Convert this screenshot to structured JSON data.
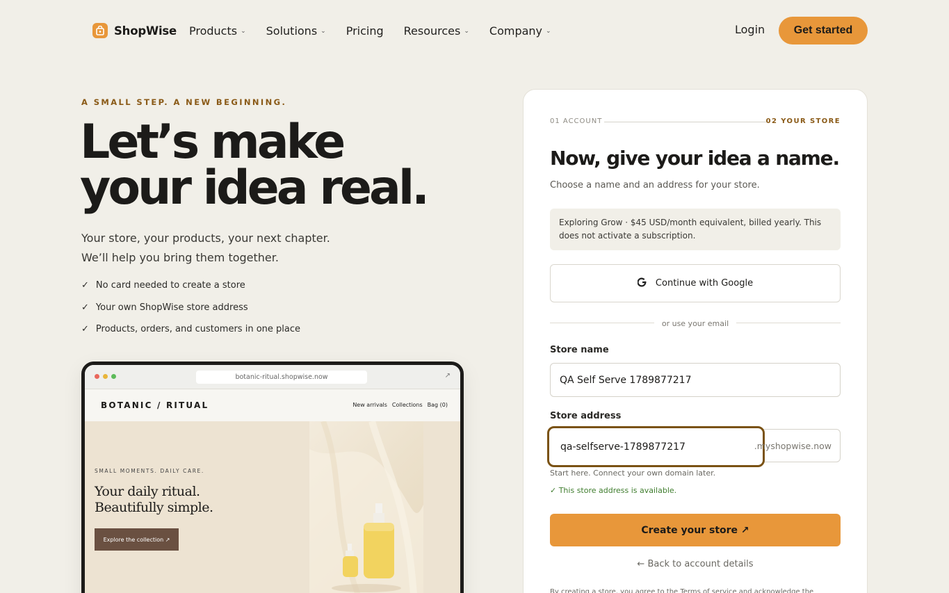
{
  "brand": {
    "name": "ShopWise",
    "accent": "#e8973a"
  },
  "nav": {
    "items": [
      {
        "label": "Products",
        "has_menu": true
      },
      {
        "label": "Solutions",
        "has_menu": true
      },
      {
        "label": "Pricing",
        "has_menu": false
      },
      {
        "label": "Resources",
        "has_menu": true
      },
      {
        "label": "Company",
        "has_menu": true
      }
    ],
    "login": "Login",
    "cta": "Get started",
    "chevron_icon": "chevron-down-icon"
  },
  "hero": {
    "eyebrow": "A SMALL STEP. A NEW BEGINNING.",
    "headline_line1": "Let’s make",
    "headline_line2": "your idea real.",
    "subhead_line1": "Your store, your products, your next chapter.",
    "subhead_line2": "We’ll help you bring them together.",
    "checklist": [
      "No card needed to create a store",
      "Your own ShopWise store address",
      "Products, orders, and customers in one place"
    ],
    "check_icon": "✓"
  },
  "preview": {
    "url": "botanic-ritual.shopwise.now",
    "store_name": "BOTANIC / RITUAL",
    "links": [
      "New arrivals",
      "Collections",
      "Bag (0)"
    ],
    "eyebrow": "SMALL MOMENTS. DAILY CARE.",
    "title_line1": "Your daily ritual.",
    "title_line2": "Beautifully simple.",
    "button": "Explore the collection ↗",
    "external_icon": "↗"
  },
  "signup": {
    "step1": "01 ACCOUNT",
    "step2": "02 YOUR STORE",
    "title": "Now, give your idea a name.",
    "subtitle": "Choose a name and an address for your store.",
    "plan_note": "Exploring Grow · $45 USD/month equivalent, billed yearly. This does not activate a subscription.",
    "google_button": "Continue with Google",
    "divider": "or use your email",
    "store_name_label": "Store name",
    "store_name_value": "QA Self Serve 1789877217",
    "store_address_label": "Store address",
    "store_address_value": "qa-selfserve-1789877217",
    "address_suffix": ".myshopwise.now",
    "address_helper": "Start here. Connect your own domain later.",
    "availability": "✓ This store address is available.",
    "create_button": "Create your store ↗",
    "back_link": "← Back to account details",
    "legal": "By creating a store, you agree to the Terms of service and acknowledge the Privacy"
  }
}
